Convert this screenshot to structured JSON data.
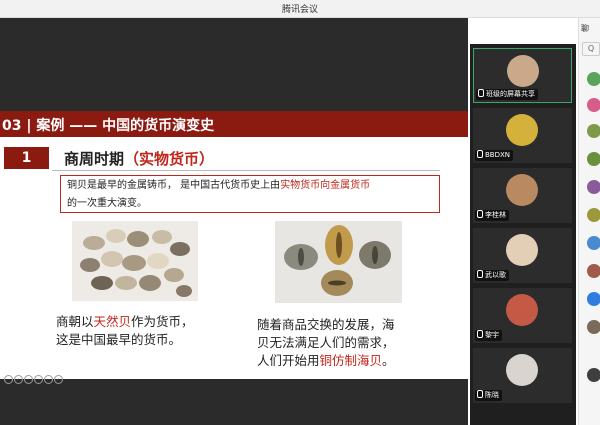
{
  "app": {
    "title": "腾讯会议"
  },
  "slide": {
    "header": "03 | 案例 —— 中国的货币演变史",
    "section_number": "1",
    "section_title": "商周时期",
    "section_title_highlight": "（实物货币）",
    "info": {
      "part1": "铜贝是最早的金属铸币， 是中国古代货币史上由",
      "highlight": "实物货币向金属货币",
      "part2": "的一次重大演变。"
    },
    "caption_left": {
      "line1_pre": "商朝以",
      "line1_highlight": "天然贝",
      "line1_post": "作为货币，",
      "line2": "这是中国最早的货币。"
    },
    "caption_right": {
      "line1": "随着商品交换的发展，海",
      "line2": "贝无法满足人们的需求，",
      "line3_pre": "人们开始用",
      "line3_highlight": "铜仿制海贝",
      "line3_post": "。"
    }
  },
  "participants": [
    {
      "name": "班级的屏幕共享",
      "avatar_color": "#c9a98a"
    },
    {
      "name": "BBDXN",
      "avatar_color": "#d4b13a"
    },
    {
      "name": "李桂林",
      "avatar_color": "#b98a62"
    },
    {
      "name": "武以歌",
      "avatar_color": "#e2cfb6"
    },
    {
      "name": "黎宇",
      "avatar_color": "#c45a45"
    },
    {
      "name": "陈晓",
      "avatar_color": "#d9d4cf"
    }
  ],
  "right_panel": {
    "top_label": "聊",
    "search_label": "Q",
    "dot_colors": [
      "#5aa35a",
      "#d85c8a",
      "#7c9a4a",
      "#6a8f3e",
      "#8a5a9a",
      "#9a9a3a",
      "#4a8acf",
      "#a05a4a",
      "#2f7de0",
      "#7a6a5a",
      "#3f3f3f"
    ]
  },
  "colors": {
    "accent_red": "#8b1a10",
    "highlight_red": "#c0261a",
    "active_green": "#3aa66a"
  }
}
